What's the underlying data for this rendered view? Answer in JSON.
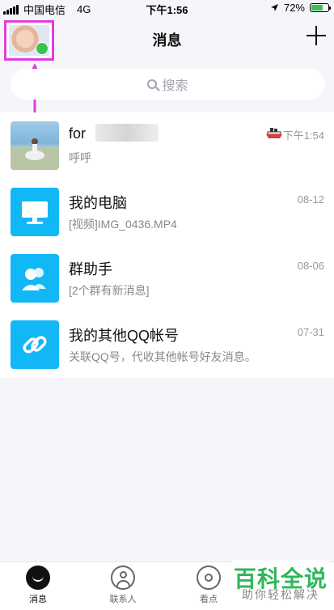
{
  "status_bar": {
    "carrier": "中国电信",
    "network": "4G",
    "time": "下午1:56",
    "battery": "72%",
    "battery_level": 0.72,
    "battery_color": "#3cc24f"
  },
  "header": {
    "title": "消息",
    "online_color": "#3cc24f"
  },
  "search": {
    "placeholder": "搜索"
  },
  "conversations": [
    {
      "title": "for",
      "subtitle": "呼呼",
      "time": "下午1:54",
      "icon": "user-photo"
    },
    {
      "title": "我的电脑",
      "subtitle": "[视频]IMG_0436.MP4",
      "time": "08-12",
      "icon": "computer-icon"
    },
    {
      "title": "群助手",
      "subtitle": "[2个群有新消息]",
      "time": "08-06",
      "icon": "group-icon"
    },
    {
      "title": "我的其他QQ帐号",
      "subtitle": "关联QQ号，代收其他帐号好友消息。",
      "time": "07-31",
      "icon": "link-icon"
    }
  ],
  "bottom_nav": {
    "items": [
      {
        "label": "消息",
        "icon": "message-icon"
      },
      {
        "label": "联系人",
        "icon": "contacts-icon"
      },
      {
        "label": "看点",
        "icon": "eye-icon"
      }
    ]
  },
  "watermark": {
    "main": "百科全说",
    "sub": "助你轻松解决"
  },
  "colors": {
    "accent": "#12b7f5",
    "annotation": "#e23ce0",
    "background": "#f5f6fa"
  }
}
